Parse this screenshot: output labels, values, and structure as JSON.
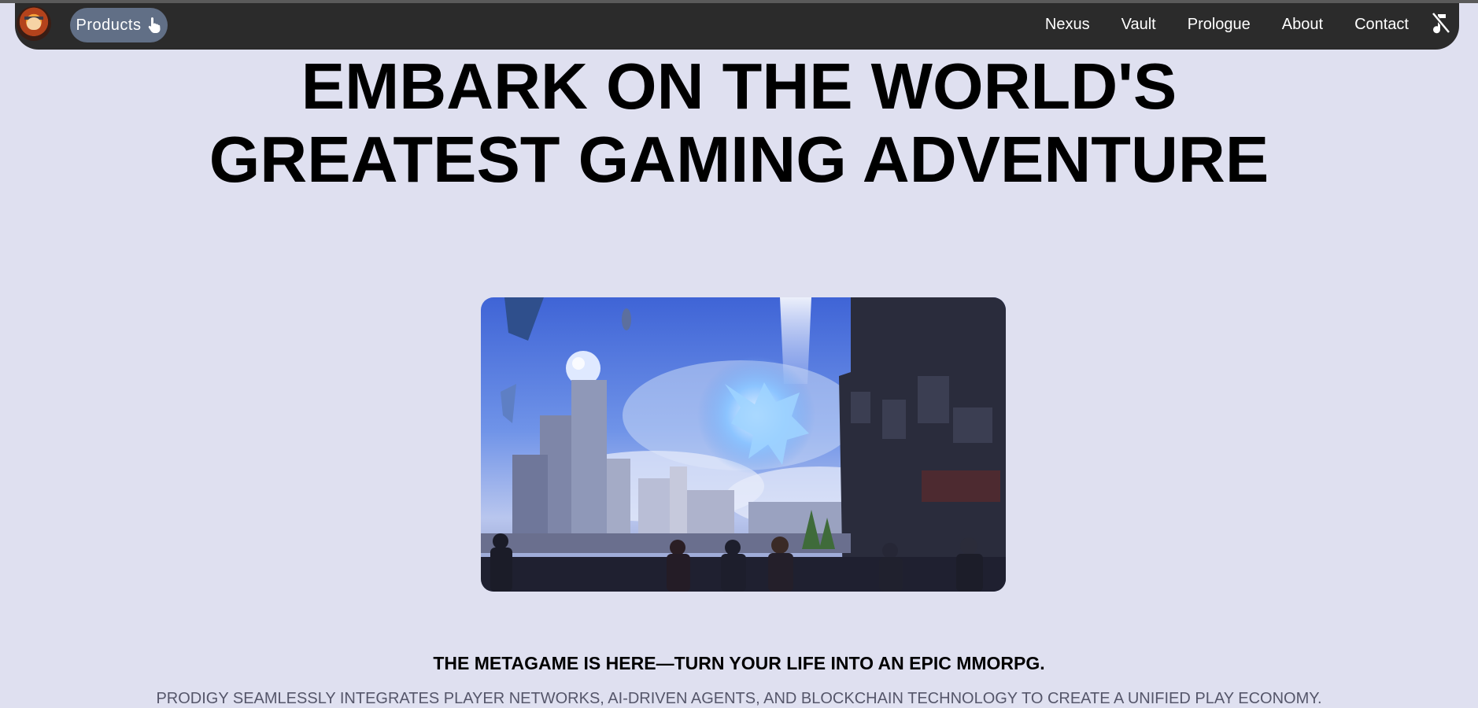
{
  "navbar": {
    "logo_icon": "ninja-avatar-logo",
    "products_label": "Products",
    "products_icon": "pointer-hand-icon",
    "links": [
      "Nexus",
      "Vault",
      "Prologue",
      "About",
      "Contact"
    ],
    "audio_icon": "music-muted-icon"
  },
  "hero": {
    "title_line1": "EMBARK ON THE WORLD'S",
    "title_line2": "GREATEST GAMING ADVENTURE",
    "image_description_icon": "fantasy-city-artwork"
  },
  "content": {
    "subheading": "THE METAGAME IS HERE—TURN YOUR LIFE INTO AN EPIC MMORPG.",
    "description": "PRODIGY SEAMLESSLY INTEGRATES PLAYER NETWORKS, AI-DRIVEN AGENTS, AND BLOCKCHAIN TECHNOLOGY TO CREATE A UNIFIED PLAY ECONOMY."
  },
  "colors": {
    "page_background": "#dfe0f0",
    "navbar_background": "#2b2b2b",
    "products_button": "#616f86",
    "description_text": "#55566a"
  }
}
